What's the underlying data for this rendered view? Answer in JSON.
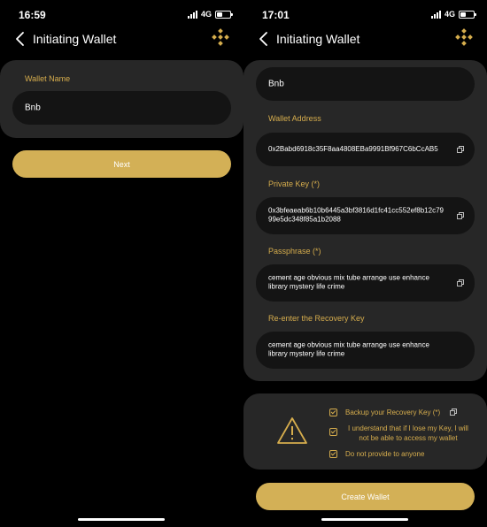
{
  "colors": {
    "accent": "#D6AD4D",
    "button": "#D3B056",
    "card": "#272727",
    "field": "#141414",
    "background": "#000000"
  },
  "left_screen": {
    "status": {
      "time": "16:59",
      "network": "4G",
      "battery_level": 0.45
    },
    "nav": {
      "title": "Initiating Wallet",
      "back_icon": "chevron-left-icon",
      "brand_icon": "binance-logo-icon"
    },
    "wallet_name_label": "Wallet Name",
    "wallet_name_value": "Bnb",
    "next_button": "Next"
  },
  "right_screen": {
    "status": {
      "time": "17:01",
      "network": "4G",
      "battery_level": 0.45
    },
    "nav": {
      "title": "Initiating Wallet",
      "back_icon": "chevron-left-icon",
      "brand_icon": "binance-logo-icon"
    },
    "name_value": "Bnb",
    "wallet_address_label": "Wallet Address",
    "wallet_address_value": "0x2Babd6918c35F8aa4808EBa9991Bf967C6bCcAB5",
    "private_key_label": "Private Key (*)",
    "private_key_value": "0x3bfeaeab6b10b6445a3bf3816d1fc41cc552ef8b12c7999e5dc348f85a1b2088",
    "passphrase_label": "Passphrase (*)",
    "passphrase_value": "cement age obvious mix tube arrange use enhance library mystery life crime",
    "reenter_label": "Re-enter the Recovery Key",
    "reenter_value": "cement age obvious mix tube arrange use enhance library mystery life crime",
    "warning_icon": "warning-triangle-icon",
    "checks": [
      {
        "text": "Backup your Recovery Key (*)",
        "checked": true
      },
      {
        "text": "I understand that if I lose my Key, I will not be able to access my wallet",
        "checked": true
      },
      {
        "text": "Do not provide to anyone",
        "checked": true
      }
    ],
    "create_button": "Create Wallet"
  }
}
